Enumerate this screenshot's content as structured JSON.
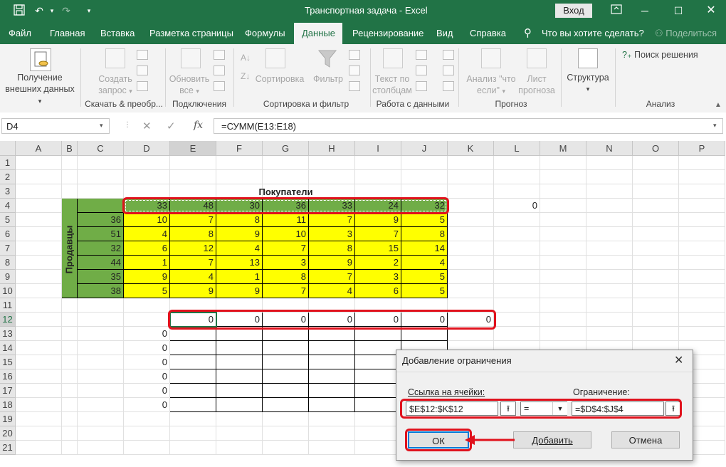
{
  "titlebar": {
    "title": "Транспортная задача  -  Excel",
    "login_label": "Вход",
    "colors": {
      "excel_green": "#217346"
    }
  },
  "tabs": [
    "Файл",
    "Главная",
    "Вставка",
    "Разметка страницы",
    "Формулы",
    "Данные",
    "Рецензирование",
    "Вид",
    "Справка",
    "Что вы хотите сделать?",
    "Поделиться"
  ],
  "ribbon": {
    "get_external": [
      "Получение",
      "внешних данных"
    ],
    "create_query": [
      "Создать",
      "запрос"
    ],
    "group_download": "Скачать & преобр...",
    "refresh_all": [
      "Обновить",
      "все"
    ],
    "group_connections": "Подключения",
    "sort": "Сортировка",
    "filter": "Фильтр",
    "group_sort_filter": "Сортировка и фильтр",
    "text_to_columns": [
      "Текст по",
      "столбцам"
    ],
    "group_data_tools": "Работа с данными",
    "whatif": [
      "Анализ \"что",
      "если\""
    ],
    "forecast_sheet": [
      "Лист",
      "прогноза"
    ],
    "group_forecast": "Прогноз",
    "structure": "Структура",
    "solver": "Поиск решения",
    "group_analysis": "Анализ"
  },
  "formula_bar": {
    "name_box": "D4",
    "formula": "=СУММ(E13:E18)",
    "fx": "fx"
  },
  "sheet": {
    "columns": [
      "A",
      "B",
      "C",
      "D",
      "E",
      "F",
      "G",
      "H",
      "I",
      "J",
      "K",
      "L",
      "M",
      "N",
      "O",
      "P"
    ],
    "rows": [
      "1",
      "2",
      "3",
      "4",
      "5",
      "6",
      "7",
      "8",
      "9",
      "10",
      "11",
      "12",
      "13",
      "14",
      "15",
      "16",
      "17",
      "18",
      "19",
      "20",
      "21"
    ],
    "buyers_label": "Покупатели",
    "sellers_label": "Продавцы",
    "demand": [
      "33",
      "48",
      "30",
      "36",
      "33",
      "24",
      "32"
    ],
    "l4_value": "0",
    "supply": [
      "36",
      "51",
      "32",
      "44",
      "35",
      "38"
    ],
    "costs": [
      [
        "10",
        "7",
        "8",
        "11",
        "7",
        "9",
        "5"
      ],
      [
        "4",
        "8",
        "9",
        "10",
        "3",
        "7",
        "8"
      ],
      [
        "6",
        "12",
        "4",
        "7",
        "8",
        "15",
        "14"
      ],
      [
        "1",
        "7",
        "13",
        "3",
        "9",
        "2",
        "4"
      ],
      [
        "9",
        "4",
        "1",
        "8",
        "7",
        "3",
        "5"
      ],
      [
        "5",
        "9",
        "9",
        "7",
        "4",
        "6",
        "5"
      ]
    ],
    "row12": [
      "0",
      "0",
      "0",
      "0",
      "0",
      "0",
      "0"
    ],
    "d_col": [
      "0",
      "0",
      "0",
      "0",
      "0",
      "0"
    ],
    "colors": {
      "green": "#70ad47",
      "yellow": "#ffff00",
      "highlight_red": "#e0121d"
    }
  },
  "dialog": {
    "title": "Добавление ограничения",
    "cell_ref_label": "Ссылка на ячейки:",
    "constraint_label": "Ограничение:",
    "cell_ref_value": "$E$12:$K$12",
    "operator": "=",
    "constraint_value": "=$D$4:$J$4",
    "ok": "ОК",
    "add": "Добавить",
    "cancel": "Отмена"
  }
}
